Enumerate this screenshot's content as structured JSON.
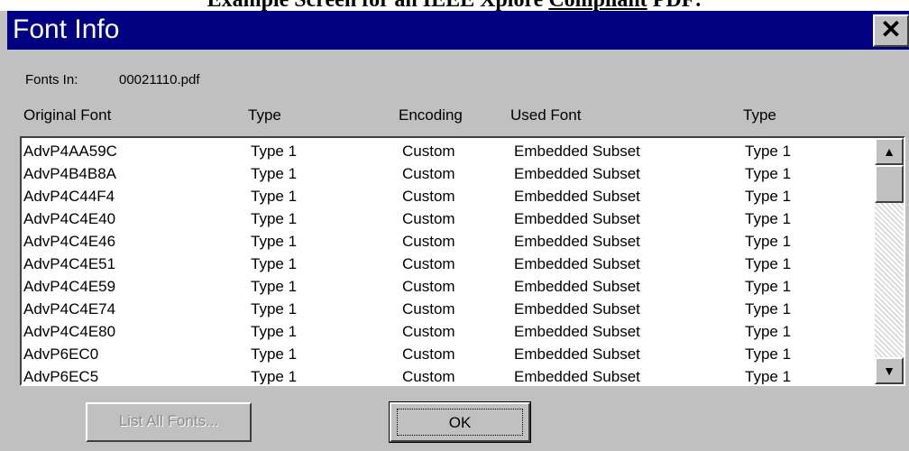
{
  "caption": {
    "prefix": "Example Screen for an IEEE Xplore ",
    "emphasis": "Compliant",
    "suffix": " PDF:"
  },
  "dialog": {
    "title": "Font Info",
    "close_label": "✕",
    "fonts_in_label": "Fonts In:",
    "fonts_in_value": "00021110.pdf",
    "columns": [
      "Original Font",
      "Type",
      "Encoding",
      "Used Font",
      "Type"
    ],
    "rows": [
      [
        "AdvP4AA59C",
        "Type 1",
        "Custom",
        "Embedded Subset",
        "Type 1"
      ],
      [
        "AdvP4B4B8A",
        "Type 1",
        "Custom",
        "Embedded Subset",
        "Type 1"
      ],
      [
        "AdvP4C44F4",
        "Type 1",
        "Custom",
        "Embedded Subset",
        "Type 1"
      ],
      [
        "AdvP4C4E40",
        "Type 1",
        "Custom",
        "Embedded Subset",
        "Type 1"
      ],
      [
        "AdvP4C4E46",
        "Type 1",
        "Custom",
        "Embedded Subset",
        "Type 1"
      ],
      [
        "AdvP4C4E51",
        "Type 1",
        "Custom",
        "Embedded Subset",
        "Type 1"
      ],
      [
        "AdvP4C4E59",
        "Type 1",
        "Custom",
        "Embedded Subset",
        "Type 1"
      ],
      [
        "AdvP4C4E74",
        "Type 1",
        "Custom",
        "Embedded Subset",
        "Type 1"
      ],
      [
        "AdvP4C4E80",
        "Type 1",
        "Custom",
        "Embedded Subset",
        "Type 1"
      ],
      [
        "AdvP6EC0",
        "Type 1",
        "Custom",
        "Embedded Subset",
        "Type 1"
      ],
      [
        "AdvP6EC5",
        "Type 1",
        "Custom",
        "Embedded Subset",
        "Type 1"
      ]
    ],
    "scroll_up_glyph": "▲",
    "scroll_down_glyph": "▼",
    "list_all_fonts_label": "List All Fonts...",
    "ok_label": "OK"
  },
  "colors": {
    "titlebar": "#000080",
    "face": "#c0c0c0"
  }
}
